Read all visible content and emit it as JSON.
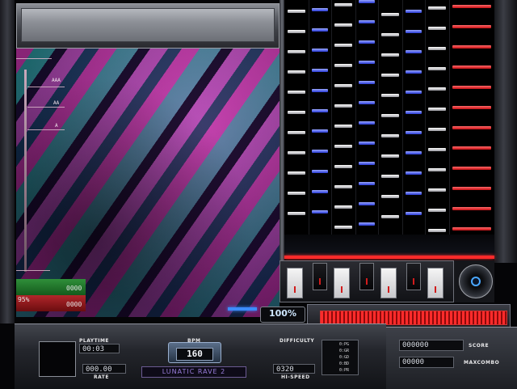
{
  "gauge_labels": [
    "AAA",
    "AA",
    "A"
  ],
  "judge_counts": {
    "green_value": "0000",
    "red_percent": "95%",
    "red_value": "0000"
  },
  "groove_gauge": {
    "percent_text": "100%",
    "percent": 100
  },
  "panel": {
    "playtime_label": "PLAYTIME",
    "playtime_value": "00:03",
    "rate_label": "RATE",
    "rate_value": "000.00",
    "bpm_label": "BPM",
    "bpm_value": "160",
    "title": "LUNATIC RAVE 2",
    "difficulty_label": "DIFFICULTY",
    "difficulty_items": [
      "0:PG",
      "0:GR",
      "0:GD",
      "0:BD",
      "0:PR"
    ],
    "hispeed_value": "0320",
    "hispeed_label": "HI-SPEED",
    "score_value": "000000",
    "score_label": "SCORE",
    "maxcombo_value": "00000",
    "maxcombo_label": "MAXCOMBO"
  },
  "icons": [
    "turntable-icon"
  ],
  "colors": {
    "judge_line": "#ff2a2a",
    "white_note": "#ffffff",
    "blue_note": "#2839d6",
    "red_note": "#c40d12",
    "gauge_fill": "#ff2b2b"
  }
}
